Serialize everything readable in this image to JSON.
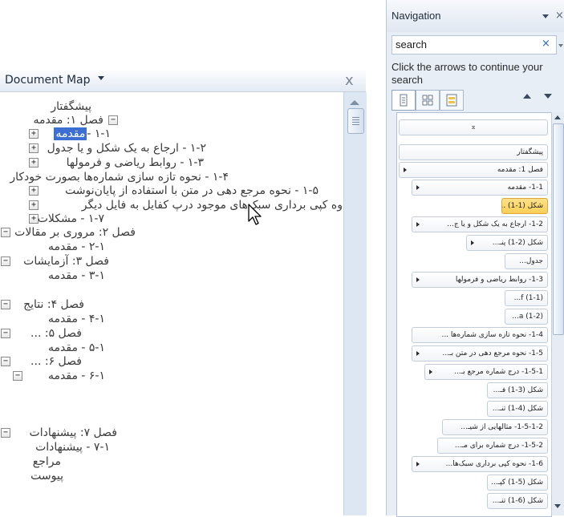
{
  "document_map": {
    "title": "Document Map",
    "close_glyph": "x",
    "items": [
      {
        "text": "پیشگفتار"
      },
      {
        "text": "فصل ۱: مقدمه"
      },
      {
        "text": "۱-۱ -",
        "selected_text": "مقدمه"
      },
      {
        "text": "۱-۲ - ارجاع به یک شکل و یا جدول"
      },
      {
        "text": "۱-۳ - روابط ریاضی و فرمولها"
      },
      {
        "text": "۱-۴ - نحوه تازه سازی شماره‌ها بصورت خودکار"
      },
      {
        "text": "۱-۵ - نحوه مرجع دهی در متن با استفاده از پایان‌نوشت"
      },
      {
        "text": "وه کپی برداری سبک‌های موجود درپ کفایل به فایل دیگر"
      },
      {
        "text": "۱-۷ - مشکلات"
      },
      {
        "text": "فصل ۲: مروری بر مقالات"
      },
      {
        "text": "۲-۱ - مقدمه"
      },
      {
        "text": "فصل ۳: آزمایشات"
      },
      {
        "text": "۳-۱ - مقدمه"
      },
      {
        "text": "فصل ۴: نتایج"
      },
      {
        "text": "۴-۱ - مقدمه"
      },
      {
        "text": "فصل ۵: ..."
      },
      {
        "text": "۵-۱ - مقدمه"
      },
      {
        "text": "فصل ۶: ..."
      },
      {
        "text": "۶-۱ - مقدمه"
      },
      {
        "text": "فصل ۷: پیشنهادات"
      },
      {
        "text": "۷-۱ - پیشنهادات"
      },
      {
        "text": "مراجع"
      },
      {
        "text": "پیوست"
      }
    ]
  },
  "navigation": {
    "title": "Navigation",
    "close_glyph": "×",
    "search_value": "search",
    "search_clear_glyph": "×",
    "hint": "Click the arrows to continue your search",
    "tabs": [
      "browse-headings",
      "browse-pages",
      "browse-results"
    ],
    "top_marker": "⌅",
    "items": [
      {
        "text": "پیشگفتار"
      },
      {
        "text": "فصل 1: مقدمه",
        "expander": true
      },
      {
        "text": "1-1- مقدمه",
        "expander": true
      },
      {
        "text": "شکل (1-1) ...",
        "highlighted": true
      },
      {
        "text": "1-2- ارجاع به یک شکل و یا ج...",
        "expander": true
      },
      {
        "text": "شکل (2-1) پنـ...",
        "expander": true
      },
      {
        "text": "جدول..."
      },
      {
        "text": "1-3- روابط ریاضی و فرمولها",
        "expander": true
      },
      {
        "text": "(1-1) f..."
      },
      {
        "text": "(1-2) a..."
      },
      {
        "text": "1-4- نحوه تازه سازی شماره‌ها ..."
      },
      {
        "text": "1-5- نحوه مرجع دهی در متن بـ...",
        "expander": true
      },
      {
        "text": "1-5-1- درج شماره مرجع بـ...",
        "expander": true
      },
      {
        "text": "شکل (3-1) فـ..."
      },
      {
        "text": "شکل (4-1) تنـ..."
      },
      {
        "text": "1-5-1-2- مثالهایی از شیـ..."
      },
      {
        "text": "1-5-2- درج شماره برای مـ..."
      },
      {
        "text": "1-6- نحوه کپی برداری سبک‌ها...",
        "expander": true
      },
      {
        "text": "شکل (5-1) کپـ..."
      },
      {
        "text": "شکل (6-1) تنـ..."
      }
    ]
  },
  "colors": {
    "selection": "#3c6fd1",
    "search_highlight": "#f9cf58",
    "pane_background": "#e8eef6"
  }
}
